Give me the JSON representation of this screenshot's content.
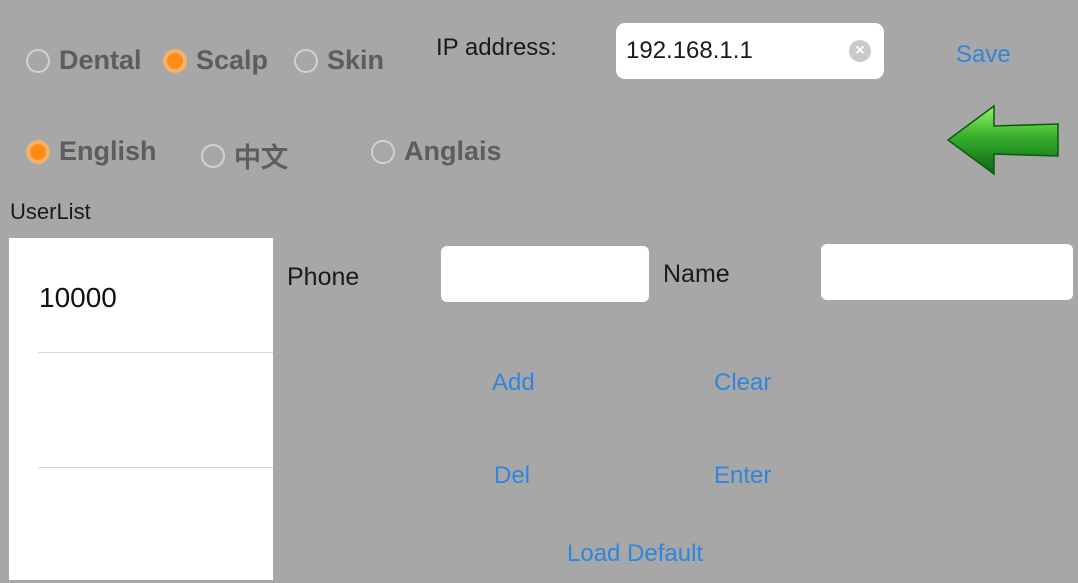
{
  "mode_options": [
    {
      "label": "Dental",
      "selected": false
    },
    {
      "label": "Scalp",
      "selected": true
    },
    {
      "label": "Skin",
      "selected": false
    }
  ],
  "language_options": [
    {
      "label": "English",
      "selected": true
    },
    {
      "label": "中文",
      "selected": false
    },
    {
      "label": "Anglais",
      "selected": false
    }
  ],
  "ip": {
    "label": "IP address:",
    "value": "192.168.1.1",
    "clear_icon": "clear-circle-icon"
  },
  "save_label": "Save",
  "back_icon": "green-left-arrow-icon",
  "userlist": {
    "title": "UserList",
    "items": [
      "10000",
      "",
      ""
    ]
  },
  "form": {
    "phone_label": "Phone",
    "phone_value": "",
    "name_label": "Name",
    "name_value": ""
  },
  "actions": {
    "add": "Add",
    "clear": "Clear",
    "del": "Del",
    "enter": "Enter",
    "load_default": "Load Default"
  },
  "colors": {
    "background": "#a7a7a7",
    "accent_orange": "#ff8a14",
    "link_blue": "#2f86dc",
    "arrow_green": "#2e9a2e"
  }
}
